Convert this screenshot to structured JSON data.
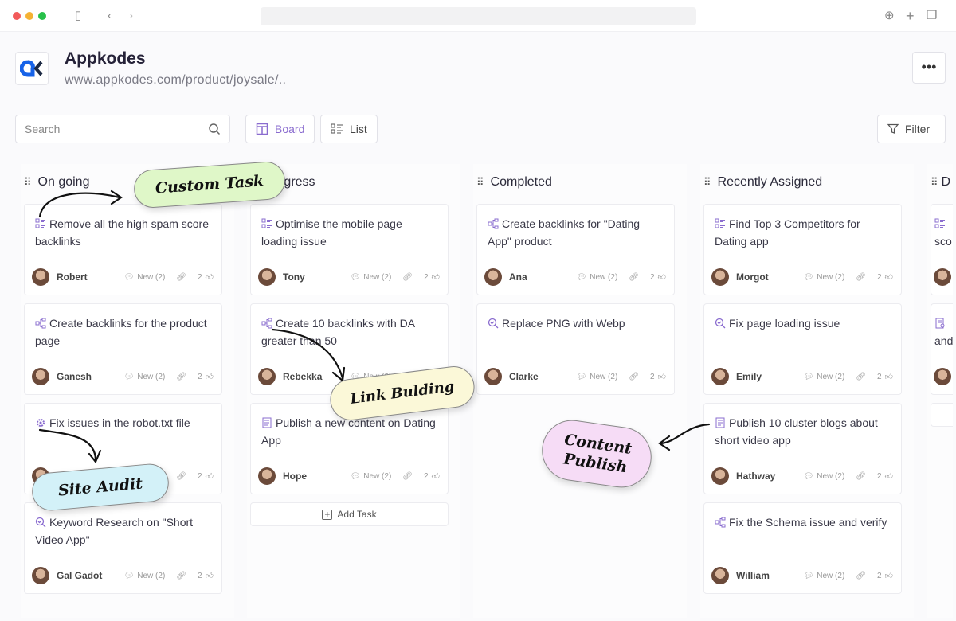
{
  "browser": {
    "icons": [
      "sidebar-icon",
      "back-icon",
      "forward-icon",
      "download-icon",
      "new-tab-icon",
      "tabs-icon"
    ]
  },
  "header": {
    "title": "Appkodes",
    "url": "www.appkodes.com/product/joysale/..",
    "more_label": "•••"
  },
  "toolbar": {
    "search_placeholder": "Search",
    "board_label": "Board",
    "list_label": "List",
    "filter_label": "Filter"
  },
  "colors": {
    "accent": "#8a6ccf",
    "custom_task": "#dff7c8",
    "link_building": "#fbf8d8",
    "site_audit": "#d3f1f8",
    "content_publish": "#f6dcf6"
  },
  "add_task_label": "Add Task",
  "columns": [
    {
      "title": "Progress",
      "cards": [
        {
          "icon": "checklist-icon",
          "title": "Optimise the mobile page loading issue",
          "owner": "Tony",
          "comments": "New (2)",
          "likes": "2"
        },
        {
          "icon": "hierarchy-icon",
          "title": "Create 10 backlinks with DA greater than 50",
          "owner": "Rebekka",
          "comments": "New (2)",
          "likes": "2"
        },
        {
          "icon": "document-icon",
          "title": "Publish a new content on Dating App",
          "owner": "Hope",
          "comments": "New (2)",
          "likes": "2"
        }
      ],
      "add_task": true
    },
    {
      "title": "On going",
      "cards": [
        {
          "icon": "checklist-icon",
          "title": "Remove all the high spam score backlinks",
          "owner": "Robert",
          "comments": "New (2)",
          "likes": "2"
        },
        {
          "icon": "hierarchy-icon",
          "title": "Create backlinks for the product page",
          "owner": "Ganesh",
          "comments": "New (2)",
          "likes": "2"
        },
        {
          "icon": "audit-icon",
          "title": "Fix issues in the robot.txt file",
          "owner": "",
          "comments": "New (2)",
          "likes": "2"
        },
        {
          "icon": "search-check-icon",
          "title": "Keyword Research on \"Short Video App\"",
          "owner": "Gal Gadot",
          "comments": "New (2)",
          "likes": "2"
        }
      ]
    },
    {
      "title": "Completed",
      "cards": [
        {
          "icon": "hierarchy-icon",
          "title": "Create backlinks for \"Dating App\" product",
          "owner": "Ana",
          "comments": "New (2)",
          "likes": "2"
        },
        {
          "icon": "search-check-icon",
          "title": "Replace PNG with Webp",
          "owner": "Clarke",
          "comments": "New (2)",
          "likes": "2"
        }
      ]
    },
    {
      "title": "Recently Assigned",
      "cards": [
        {
          "icon": "checklist-icon",
          "title": "Find Top 3 Competitors for Dating app",
          "owner": "Morgot",
          "comments": "New (2)",
          "likes": "2"
        },
        {
          "icon": "search-check-icon",
          "title": "Fix page loading issue",
          "owner": "Emily",
          "comments": "New (2)",
          "likes": "2"
        },
        {
          "icon": "document-icon",
          "title": "Publish 10 cluster blogs about short video app",
          "owner": "Hathway",
          "comments": "New (2)",
          "likes": "2"
        },
        {
          "icon": "hierarchy-icon",
          "title": "Fix the Schema issue and verify",
          "owner": "William",
          "comments": "New (2)",
          "likes": "2"
        }
      ]
    },
    {
      "title": "D",
      "cards": [
        {
          "icon": "checklist-icon",
          "title": "sco",
          "owner": "",
          "comments": "",
          "likes": ""
        },
        {
          "icon": "document-search-icon",
          "title": "and",
          "owner": "",
          "comments": "",
          "likes": ""
        }
      ],
      "add_task": true,
      "partial": true
    }
  ],
  "stickers": {
    "custom_task": "Custom Task",
    "link_building": "Link Bulding",
    "site_audit": "Site Audit",
    "content_publish_1": "Content",
    "content_publish_2": "Publish"
  }
}
